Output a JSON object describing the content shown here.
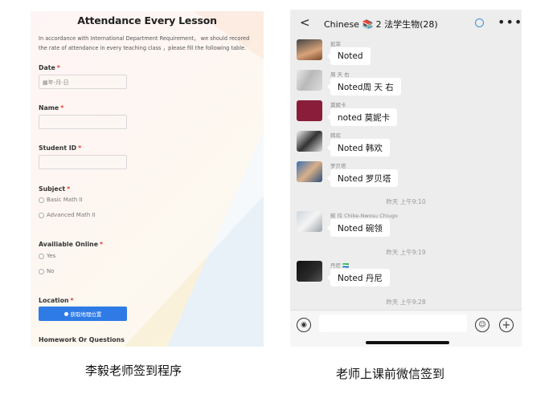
{
  "form": {
    "title": "Attendance Every Lesson",
    "description": "In accordance with International Department Requirement， we should recored the rate of attendance in every teaching class ，please fill the following table.",
    "required_mark": "*",
    "date_label": "Date",
    "date_placeholder": "年-月-日",
    "name_label": "Name",
    "student_id_label": "Student ID",
    "subject_label": "Subject",
    "subject_options": [
      "Basic Math II",
      "Advanced Math II"
    ],
    "online_label": "Availiable Online",
    "online_options": [
      "Yes",
      "No"
    ],
    "location_label": "Location",
    "location_button": "获取地理位置",
    "homework_label": "Homework Or Questions"
  },
  "captions": {
    "left": "李毅老师签到程序",
    "right": "老师上课前微信签到"
  },
  "chat": {
    "title": "Chinese 📚 2 法学生物(28)",
    "messages": [
      {
        "sender": "如菲",
        "text": "Noted"
      },
      {
        "sender": "周 天 右",
        "text": "Noted周 天 右"
      },
      {
        "sender": "莫妮卡",
        "text": "noted 莫妮卡"
      },
      {
        "sender": "韩欢",
        "text": "Noted 韩欢"
      },
      {
        "sender": "罗贝塔",
        "text": "Noted 罗贝塔"
      },
      {
        "sender": "碗 玲 Chike-Nwosu Chiugo",
        "text": "Noted 碗领"
      },
      {
        "sender": "丹尼 🇸🇱",
        "text": "Noted 丹尼"
      }
    ],
    "timestamps": [
      "昨天 上午9:10",
      "昨天 上午9:19",
      "昨天 上午9:28"
    ]
  },
  "colors": {
    "accent_blue": "#2f7be6",
    "required_red": "#e0403a",
    "chat_bg": "#ededed"
  }
}
